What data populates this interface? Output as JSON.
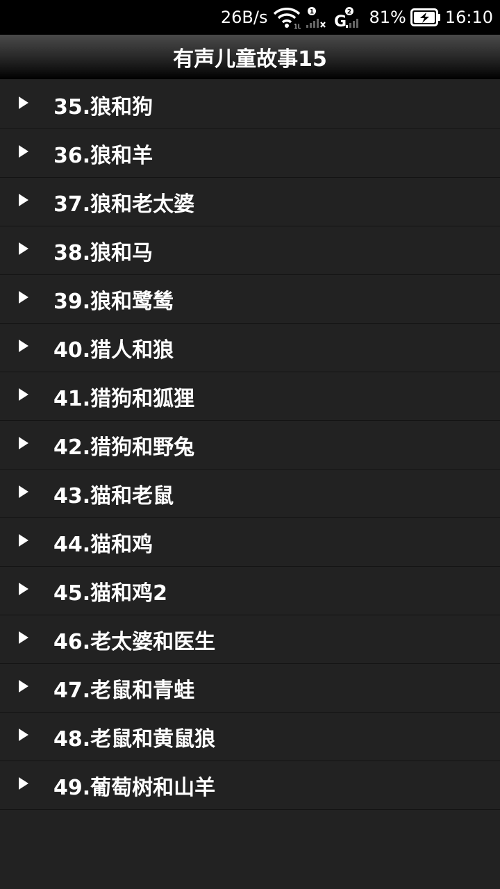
{
  "status_bar": {
    "net_speed": "26B/s",
    "sim1_badge": "1",
    "sim1_net": "1L",
    "sim2_badge": "2",
    "sim2_net": "G",
    "battery_percent": "81%",
    "time": "16:10",
    "icons": [
      "wifi-icon",
      "sim1-signal-icon",
      "sim2-signal-icon",
      "battery-charging-icon"
    ]
  },
  "header": {
    "title": "有声儿童故事15"
  },
  "stories": [
    {
      "label": "35.狼和狗"
    },
    {
      "label": "36.狼和羊"
    },
    {
      "label": "37.狼和老太婆"
    },
    {
      "label": "38.狼和马"
    },
    {
      "label": "39.狼和鹭鸶"
    },
    {
      "label": "40.猎人和狼"
    },
    {
      "label": "41.猎狗和狐狸"
    },
    {
      "label": "42.猎狗和野兔"
    },
    {
      "label": "43.猫和老鼠"
    },
    {
      "label": "44.猫和鸡"
    },
    {
      "label": "45.猫和鸡2"
    },
    {
      "label": "46.老太婆和医生"
    },
    {
      "label": "47.老鼠和青蛙"
    },
    {
      "label": "48.老鼠和黄鼠狼"
    },
    {
      "label": "49.葡萄树和山羊"
    }
  ],
  "colors": {
    "background": "#222222",
    "status_bar": "#000000",
    "text": "#ffffff",
    "divider": "#141414"
  }
}
